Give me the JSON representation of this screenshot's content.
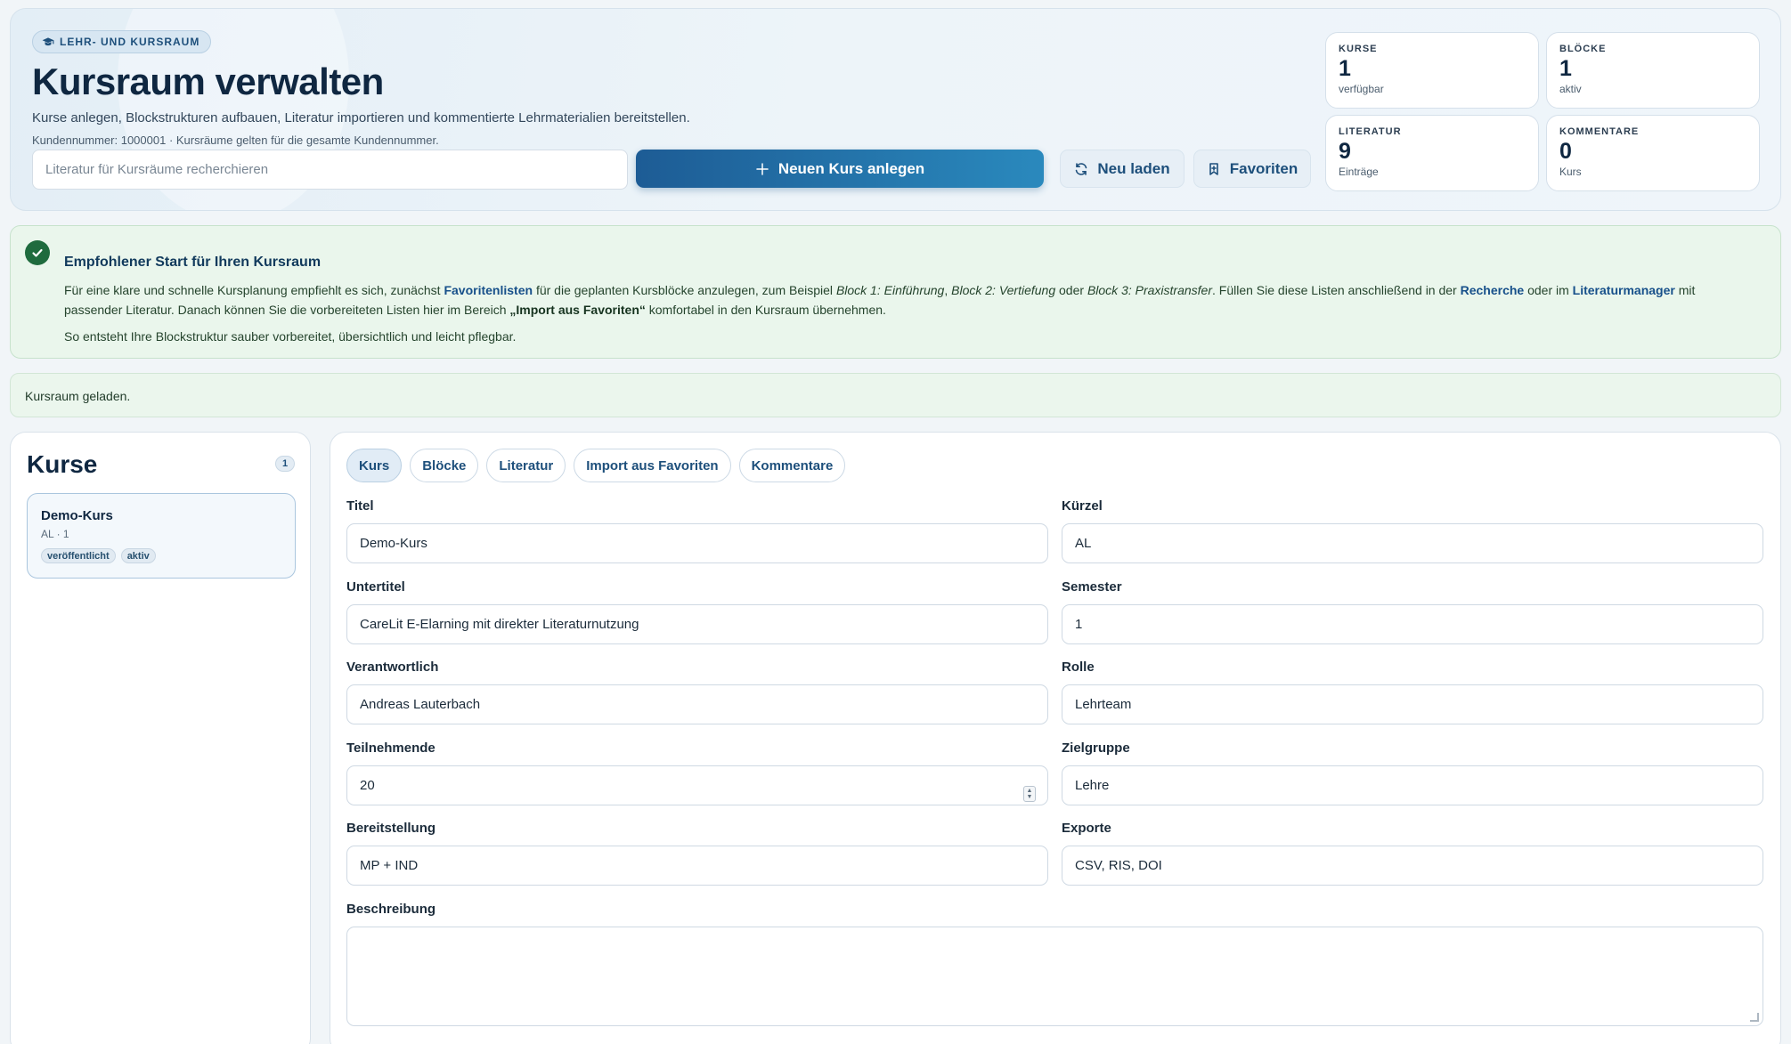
{
  "hero": {
    "badge": "LEHR- UND KURSRAUM",
    "title": "Kursraum verwalten",
    "subtitle": "Kurse anlegen, Blockstrukturen aufbauen, Literatur importieren und kommentierte Lehrmaterialien bereitstellen.",
    "note": "Kundennummer: 1000001 · Kursräume gelten für die gesamte Kundennummer.",
    "search_placeholder": "Literatur für Kursräume recherchieren",
    "new_course_label": "Neuen Kurs anlegen",
    "reload_label": "Neu laden",
    "favorites_label": "Favoriten"
  },
  "stats": [
    {
      "label": "KURSE",
      "value": "1",
      "unit": "verfügbar"
    },
    {
      "label": "BLÖCKE",
      "value": "1",
      "unit": "aktiv"
    },
    {
      "label": "LITERATUR",
      "value": "9",
      "unit": "Einträge"
    },
    {
      "label": "KOMMENTARE",
      "value": "0",
      "unit": "Kurs"
    }
  ],
  "info": {
    "title": "Empfohlener Start für Ihren Kursraum",
    "t1": "Für eine klare und schnelle Kursplanung empfiehlt es sich, zunächst ",
    "l1": "Favoritenlisten",
    "t2": " für die geplanten Kursblöcke anzulegen, zum Beispiel ",
    "i1": "Block 1: Einführung",
    "t3": ", ",
    "i2": "Block 2: Vertiefung",
    "t4": " oder ",
    "i3": "Block 3: Praxistransfer",
    "t5": ". Füllen Sie diese Listen anschließend in der ",
    "l2": "Recherche",
    "t6": " oder im ",
    "l3": "Literaturmanager",
    "t7": " mit passender Literatur. Danach können Sie die vorbereiteten Listen hier im Bereich ",
    "b1": "„Import aus Favoriten“",
    "t8": " komfortabel in den Kursraum übernehmen.",
    "footer": "So entsteht Ihre Blockstruktur sauber vorbereitet, übersichtlich und leicht pflegbar."
  },
  "status": "Kursraum geladen.",
  "courses": {
    "title": "Kurse",
    "count": "1",
    "items": [
      {
        "name": "Demo-Kurs",
        "meta": "AL · 1",
        "tags": [
          "veröffentlicht",
          "aktiv"
        ]
      }
    ]
  },
  "tabs": [
    "Kurs",
    "Blöcke",
    "Literatur",
    "Import aus Favoriten",
    "Kommentare"
  ],
  "form": {
    "titel": {
      "label": "Titel",
      "value": "Demo-Kurs"
    },
    "kuerzel": {
      "label": "Kürzel",
      "value": "AL"
    },
    "untertitel": {
      "label": "Untertitel",
      "value": "CareLit E-Elarning mit direkter Literaturnutzung"
    },
    "semester": {
      "label": "Semester",
      "value": "1"
    },
    "verantwortlich": {
      "label": "Verantwortlich",
      "value": "Andreas Lauterbach"
    },
    "rolle": {
      "label": "Rolle",
      "value": "Lehrteam"
    },
    "teilnehmende": {
      "label": "Teilnehmende",
      "value": "20"
    },
    "zielgruppe": {
      "label": "Zielgruppe",
      "value": "Lehre"
    },
    "bereitstellung": {
      "label": "Bereitstellung",
      "value": "MP + IND"
    },
    "exporte": {
      "label": "Exporte",
      "value": "CSV, RIS, DOI"
    },
    "beschreibung": {
      "label": "Beschreibung",
      "value": ""
    }
  }
}
